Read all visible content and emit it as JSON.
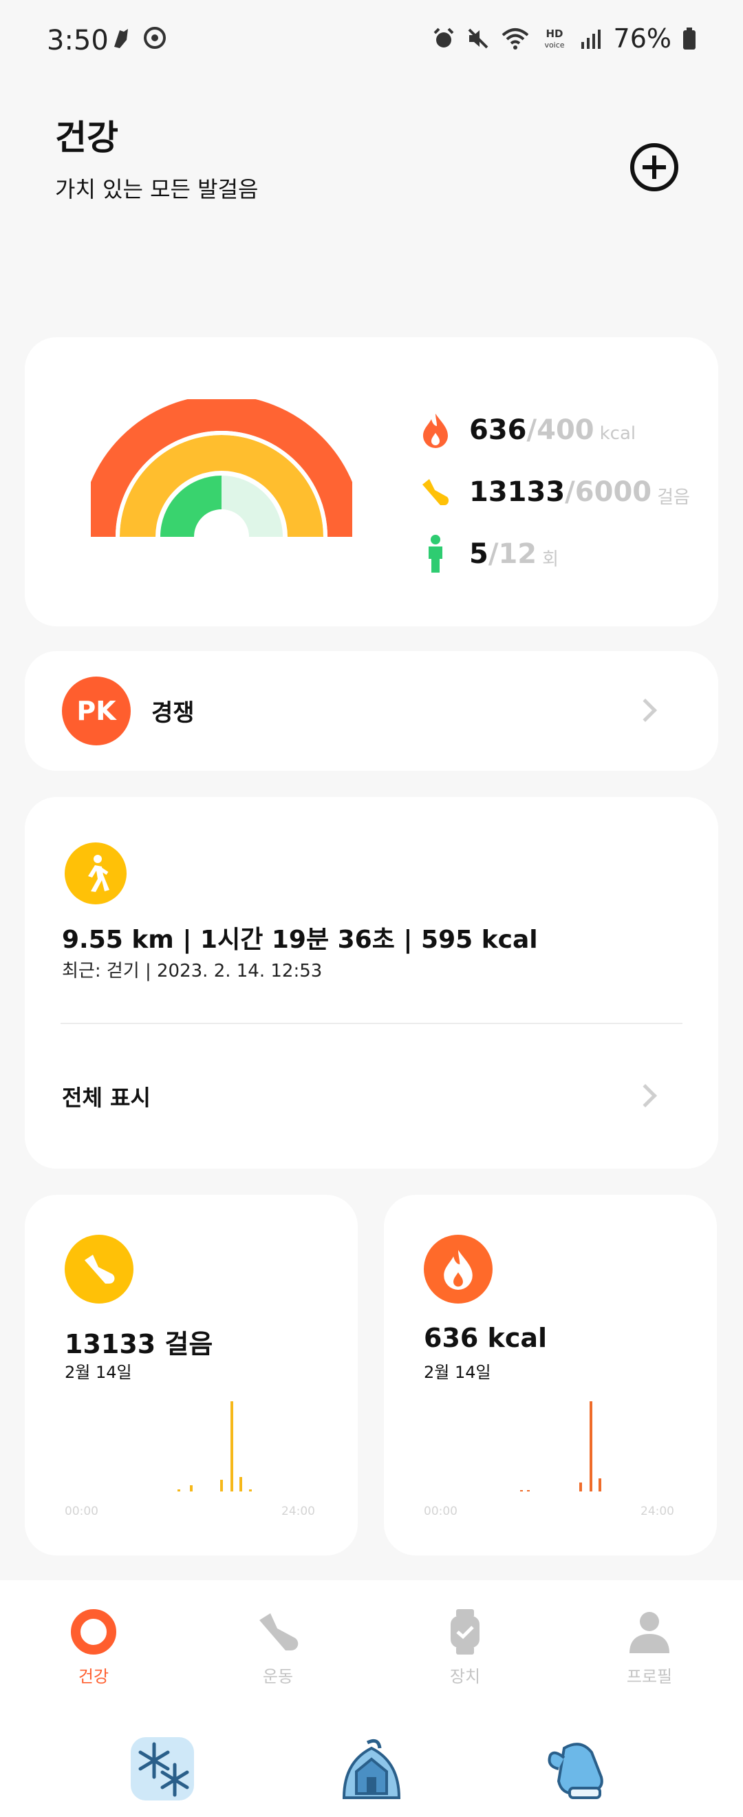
{
  "status_bar": {
    "time": "3:50",
    "battery": "76%",
    "left_icons": [
      "notification-icon",
      "app-icon"
    ],
    "right_icons": [
      "alarm-icon",
      "mute-icon",
      "wifi-icon",
      "hd-voice-icon",
      "signal-icon",
      "battery-icon"
    ],
    "hd_label": "HD",
    "voice_label": "voice"
  },
  "header": {
    "title": "건강",
    "subtitle": "가치 있는 모든 발걸음",
    "add_icon": "plus-circle-icon"
  },
  "activity": {
    "calories": {
      "current": "636",
      "goal": "/400",
      "unit": "kcal",
      "icon": "flame-icon",
      "color": "#ff6433"
    },
    "steps": {
      "current": "13133",
      "goal": "/6000",
      "unit": "걸음",
      "icon": "shoe-icon",
      "color": "#ffc107"
    },
    "stand": {
      "current": "5",
      "goal": "/12",
      "unit": "회",
      "icon": "person-icon",
      "color": "#2ecc71"
    },
    "rings_progress": {
      "calories": 1.0,
      "steps": 1.0,
      "stand": 0.42
    }
  },
  "pk": {
    "badge": "PK",
    "label": "경쟁"
  },
  "recent_walk": {
    "icon": "walking-icon",
    "summary": "9.55 km | 1시간 19분 36초 | 595 kcal",
    "subtitle": "최근: 걷기 | 2023. 2. 14. 12:53",
    "show_all": "전체 표시"
  },
  "steps_card": {
    "value": "13133 걸음",
    "date": "2월 14일",
    "color": "#f6b81a",
    "axis_start": "00:00",
    "axis_end": "24:00"
  },
  "calories_card": {
    "value": "636 kcal",
    "date": "2월 14일",
    "color": "#ef6c2a",
    "axis_start": "00:00",
    "axis_end": "24:00"
  },
  "bottom_nav": {
    "items": [
      {
        "label": "건강",
        "icon": "health-ring-icon",
        "active": true
      },
      {
        "label": "운동",
        "icon": "shoe-icon",
        "active": false
      },
      {
        "label": "장치",
        "icon": "watch-icon",
        "active": false
      },
      {
        "label": "프로필",
        "icon": "profile-icon",
        "active": false
      }
    ]
  },
  "dock": {
    "items": [
      {
        "icon": "snowflake-icon"
      },
      {
        "icon": "house-icon"
      },
      {
        "icon": "mitten-icon"
      }
    ]
  }
}
